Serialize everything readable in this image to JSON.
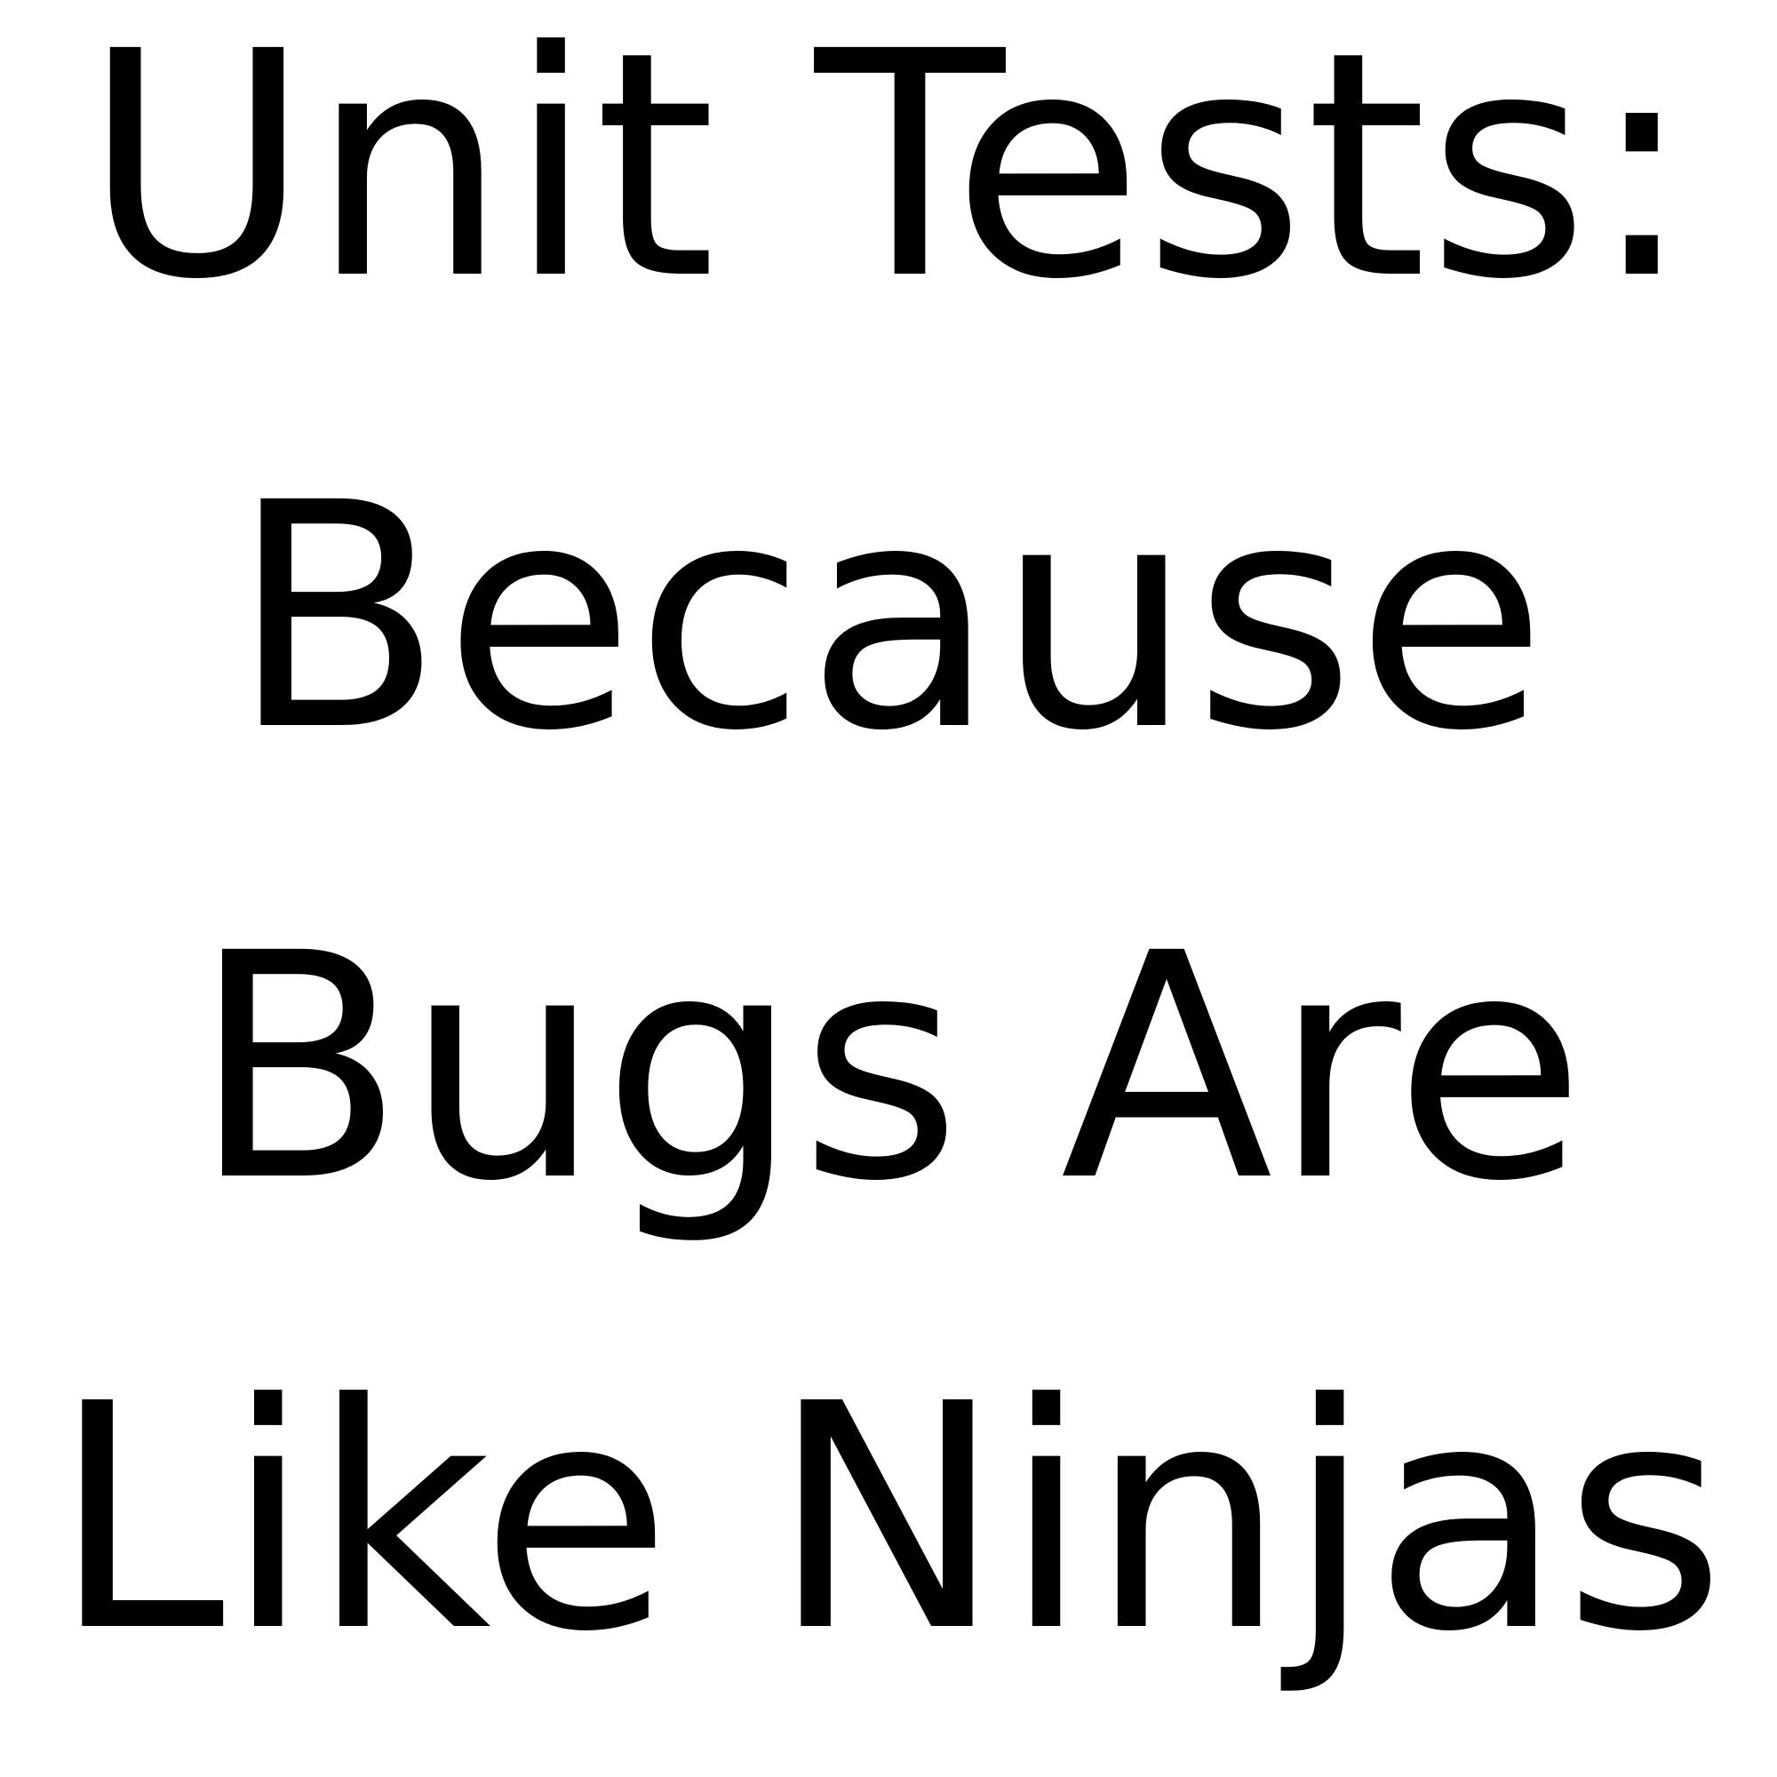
{
  "lines": [
    "Unit Tests:",
    "Because",
    "Bugs Are",
    "Like Ninjas"
  ],
  "colors": {
    "background": "#ffffff",
    "text": "#000000"
  }
}
